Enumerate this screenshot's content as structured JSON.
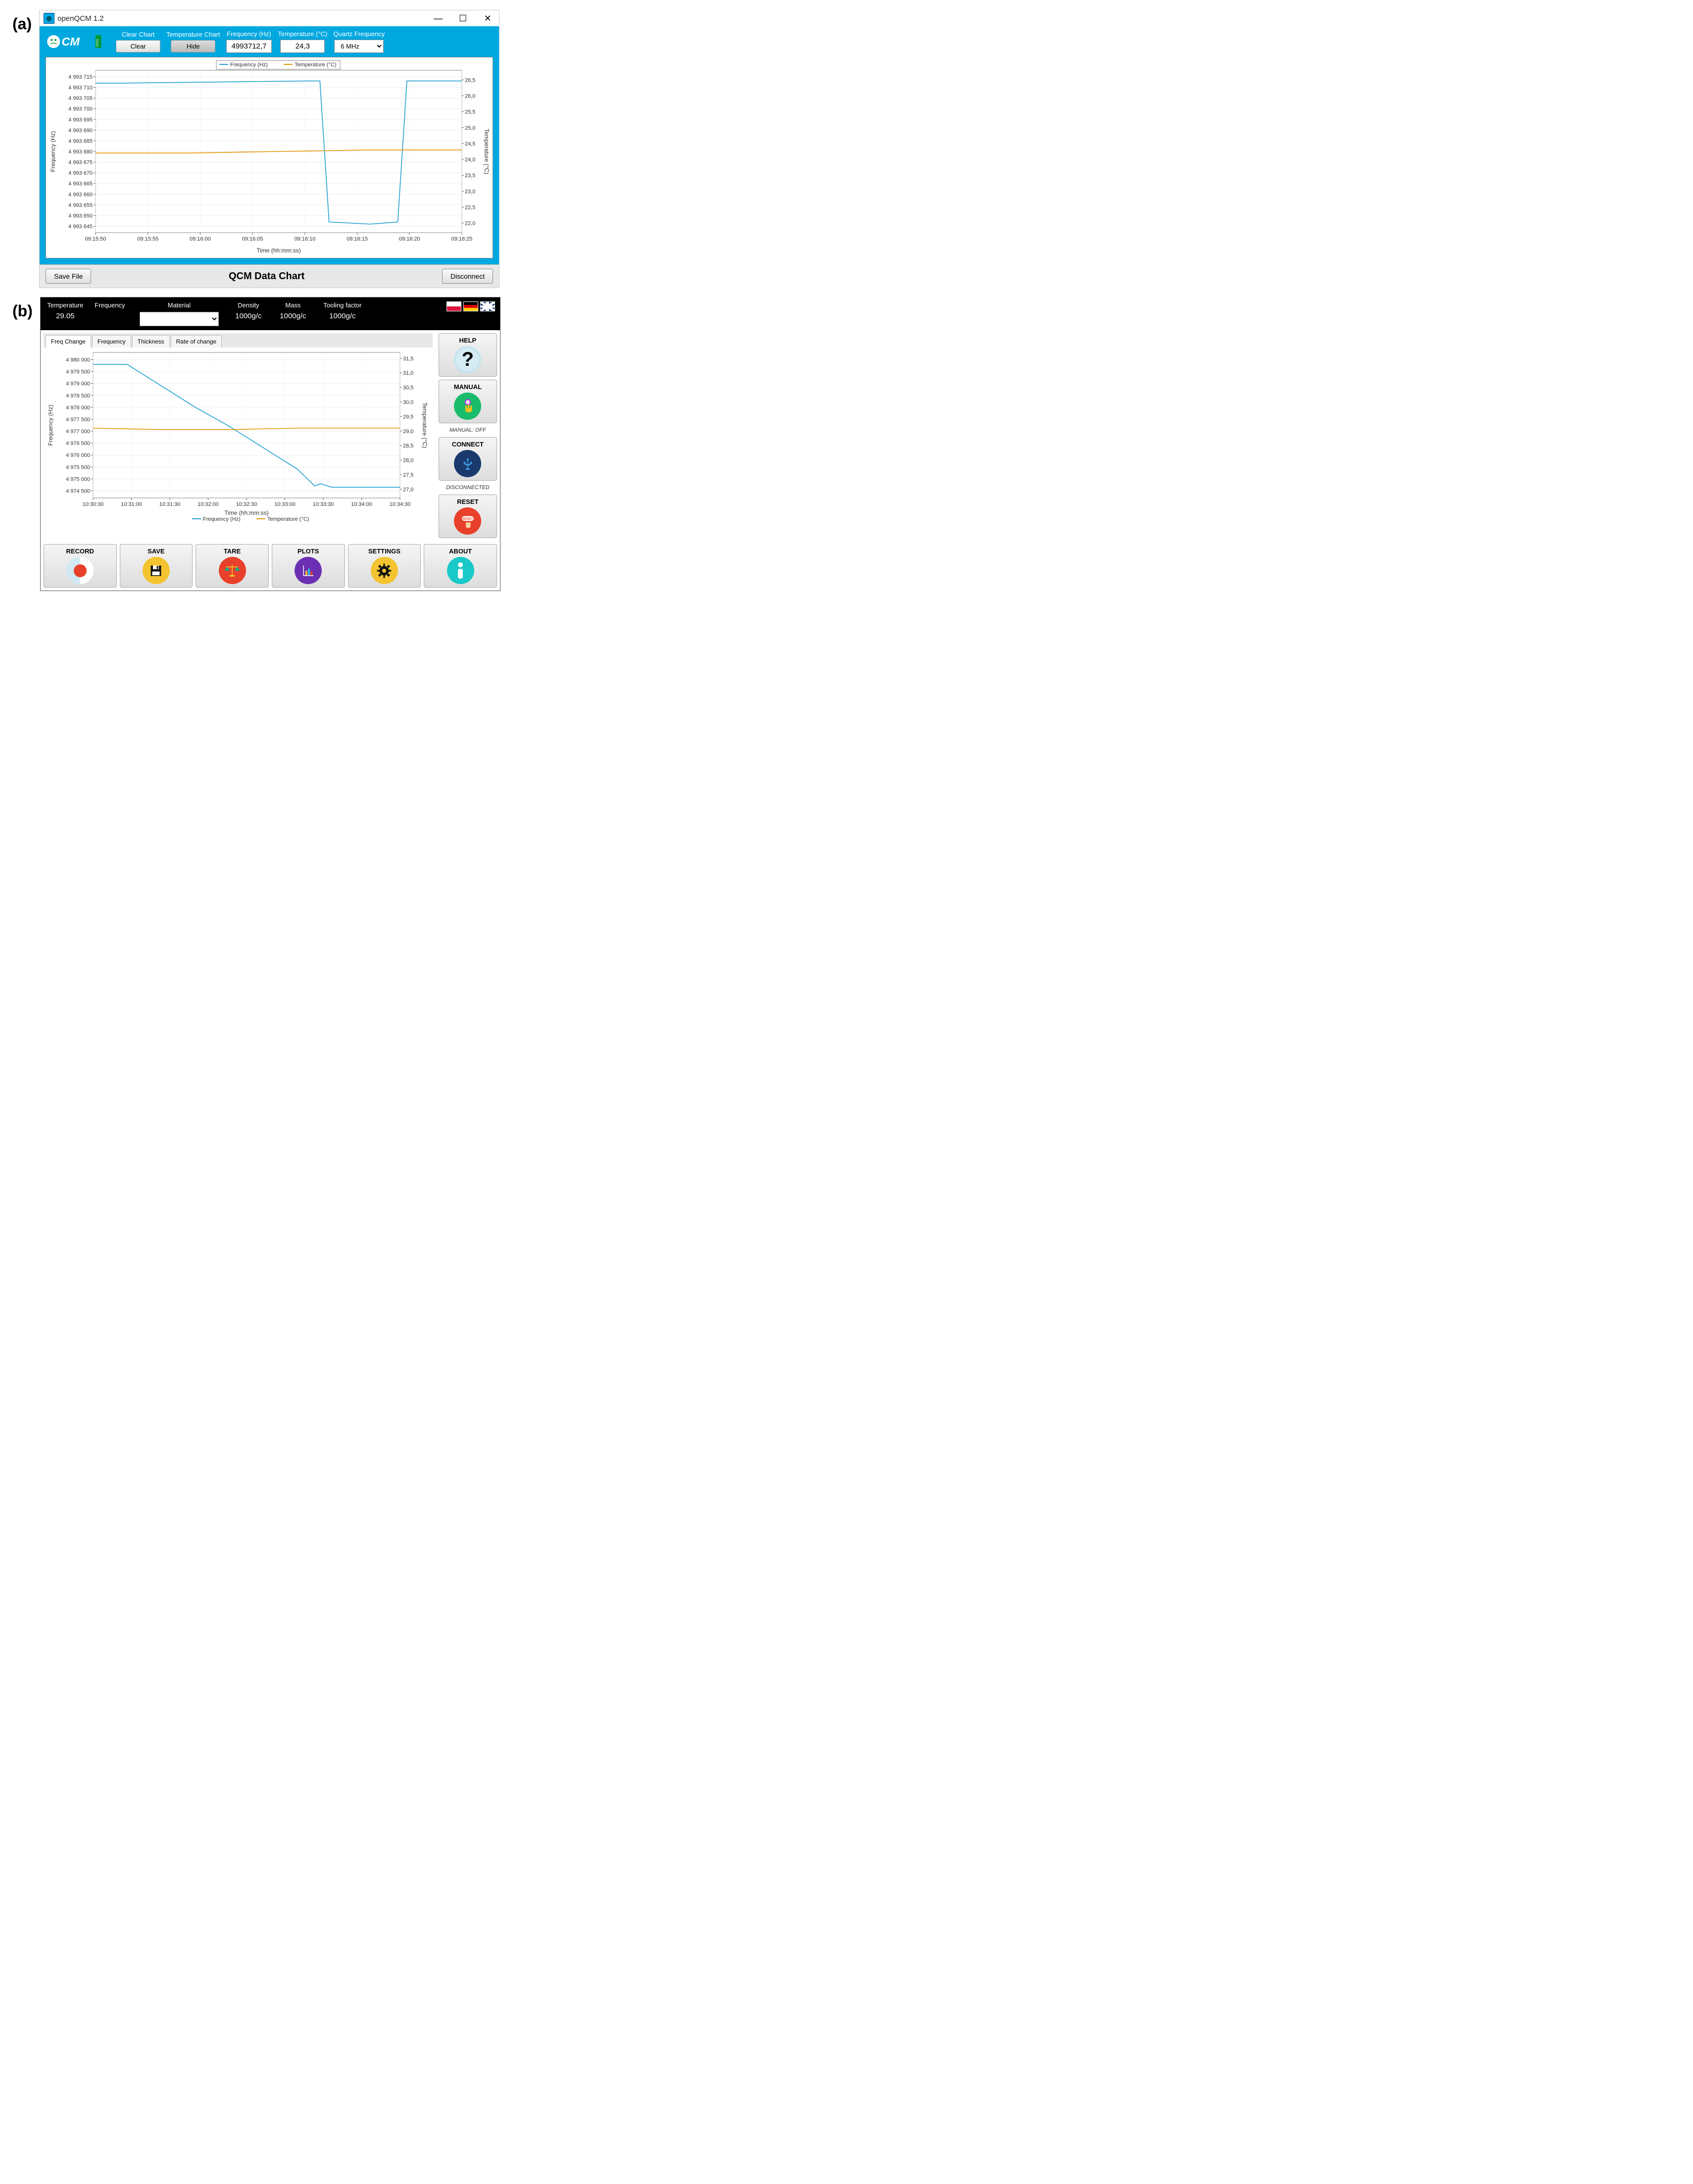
{
  "panel_a_label": "(a)",
  "panel_b_label": "(b)",
  "a": {
    "window_title": "openQCM 1.2",
    "header": {
      "clear_label": "Clear Chart",
      "clear_btn": "Clear",
      "temp_chart_label": "Temperature Chart",
      "temp_chart_btn": "Hide",
      "freq_label": "Frequency (Hz)",
      "freq_value": "4993712,7",
      "temp_label": "Temperature (°C)",
      "temp_value": "24,3",
      "quartz_label": "Quartz Frequency",
      "quartz_value": "6  MHz"
    },
    "chart_title": "QCM Data Chart",
    "save_btn": "Save File",
    "disconnect_btn": "Disconnect"
  },
  "b": {
    "header": {
      "temp_label": "Temperature",
      "temp_value": "29.05",
      "freq_label": "Frequency",
      "freq_value": "",
      "material_label": "Material",
      "density_label": "Density",
      "density_value": "1000g/c",
      "mass_label": "Mass",
      "mass_value": "1000g/c",
      "tooling_label": "Tooling factor",
      "tooling_value": "1000g/c"
    },
    "tabs": [
      "Freq Change",
      "Frequency",
      "Thickness",
      "Rate of change"
    ],
    "side": {
      "help": "HELP",
      "manual": "MANUAL",
      "manual_status": "MANUAL: OFF",
      "connect": "CONNECT",
      "connect_status": "DISCONNECTED",
      "reset": "RESET"
    },
    "bottom": [
      "RECORD",
      "SAVE",
      "TARE",
      "PLOTS",
      "SETTINGS",
      "ABOUT"
    ]
  },
  "chart_data": [
    {
      "panel": "a",
      "type": "line",
      "xlabel": "Time (hh:mm:ss)",
      "ylabel_left": "Frequency (Hz)",
      "ylabel_right": "Temperature (°C)",
      "x_ticks": [
        "09:15:50",
        "09:15:55",
        "09:16:00",
        "09:16:05",
        "09:16:10",
        "09:16:15",
        "09:16:20",
        "09:16:25"
      ],
      "y_left_ticks": [
        4993645,
        4993650,
        4993655,
        4993660,
        4993665,
        4993670,
        4993675,
        4993680,
        4993685,
        4993690,
        4993695,
        4993700,
        4993705,
        4993710,
        4993715
      ],
      "y_left_range": [
        4993642,
        4993718
      ],
      "y_right_ticks": [
        22.0,
        22.5,
        23.0,
        23.5,
        24.0,
        24.5,
        25.0,
        25.5,
        26.0,
        26.5
      ],
      "y_right_range": [
        21.7,
        26.8
      ],
      "legend": [
        "Frequency (Hz)",
        "Temperature (°C)"
      ],
      "series": [
        {
          "name": "Frequency (Hz)",
          "axis": "left",
          "color": "#1f9ed1",
          "points": [
            [
              0,
              4993712
            ],
            [
              3,
              4993712
            ],
            [
              23,
              4993713
            ],
            [
              24.5,
              4993713
            ],
            [
              25.5,
              4993647
            ],
            [
              30,
              4993646
            ],
            [
              33,
              4993647
            ],
            [
              34,
              4993713
            ],
            [
              40,
              4993713
            ]
          ]
        },
        {
          "name": "Temperature (°C)",
          "axis": "right",
          "color": "#e59400",
          "points": [
            [
              0,
              24.2
            ],
            [
              10,
              24.2
            ],
            [
              20,
              24.25
            ],
            [
              30,
              24.3
            ],
            [
              40,
              24.3
            ]
          ]
        }
      ]
    },
    {
      "panel": "b",
      "type": "line",
      "xlabel": "Time (hh:mm:ss)",
      "ylabel_left": "Frequency (Hz)",
      "ylabel_right": "Temperature (°C)",
      "x_ticks": [
        "10:30:30",
        "10:31:00",
        "10:31:30",
        "10:32:00",
        "10:32:30",
        "10:33:00",
        "10:33:30",
        "10:34:00",
        "10:34:30"
      ],
      "y_left_ticks": [
        4974500,
        4975000,
        4975500,
        4976000,
        4976500,
        4977000,
        4977500,
        4978000,
        4978500,
        4979000,
        4979500,
        4980000
      ],
      "y_left_range": [
        4974200,
        4980300
      ],
      "y_right_ticks": [
        27.0,
        27.5,
        28.0,
        28.5,
        29.0,
        29.5,
        30.0,
        30.5,
        31.0,
        31.5
      ],
      "y_right_range": [
        26.7,
        31.7
      ],
      "legend": [
        "Frequency (Hz)",
        "Temperature (°C)"
      ],
      "series": [
        {
          "name": "Frequency (Hz)",
          "axis": "left",
          "color": "#1f9ed1",
          "points": [
            [
              0,
              4979800
            ],
            [
              30,
              4979800
            ],
            [
              60,
              4978900
            ],
            [
              90,
              4978000
            ],
            [
              120,
              4977200
            ],
            [
              150,
              4976300
            ],
            [
              180,
              4975400
            ],
            [
              195,
              4974700
            ],
            [
              200,
              4974800
            ],
            [
              210,
              4974650
            ],
            [
              240,
              4974650
            ],
            [
              270,
              4974650
            ]
          ]
        },
        {
          "name": "Temperature (°C)",
          "axis": "right",
          "color": "#e59400",
          "points": [
            [
              0,
              29.1
            ],
            [
              60,
              29.05
            ],
            [
              120,
              29.05
            ],
            [
              180,
              29.1
            ],
            [
              240,
              29.1
            ],
            [
              270,
              29.1
            ]
          ]
        }
      ]
    }
  ]
}
